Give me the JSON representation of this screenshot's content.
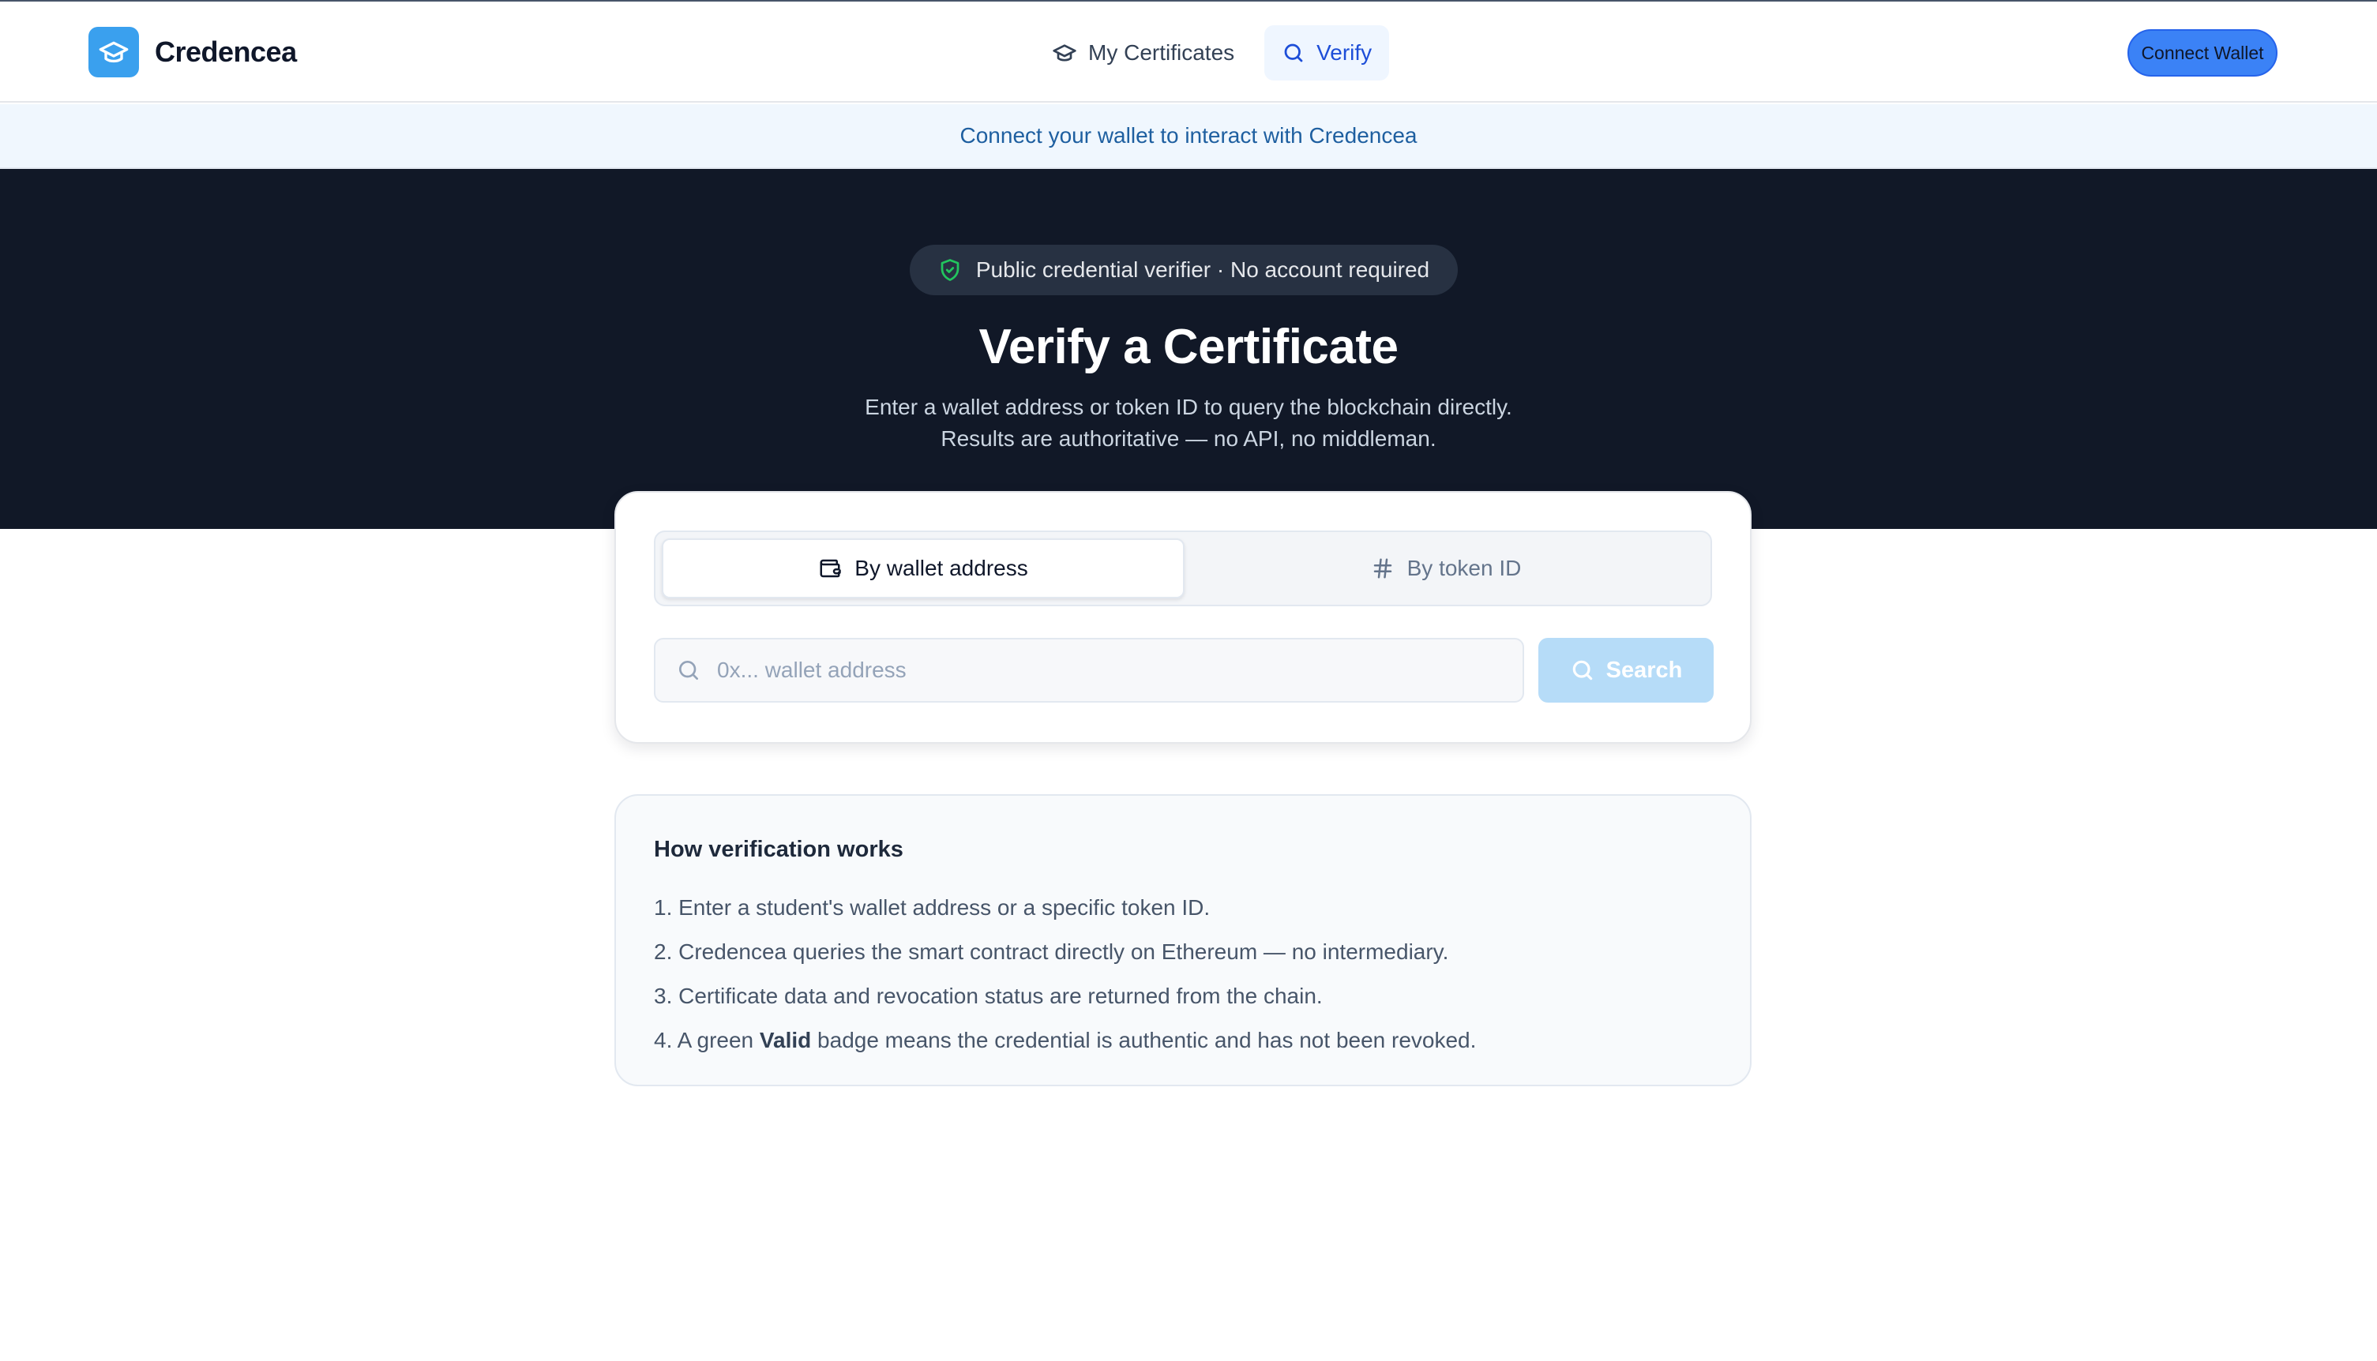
{
  "app": {
    "name": "Credencea"
  },
  "nav": {
    "items": [
      {
        "label": "My Certificates",
        "icon": "graduation-cap-icon",
        "active": false
      },
      {
        "label": "Verify",
        "icon": "search-icon",
        "active": true
      }
    ]
  },
  "header": {
    "connect_label": "Connect Wallet"
  },
  "notice": {
    "text": "Connect your wallet to interact with Credencea"
  },
  "hero": {
    "badge": "Public credential verifier · No account required",
    "title": "Verify a Certificate",
    "subtitle_line1": "Enter a wallet address or token ID to query the blockchain directly.",
    "subtitle_line2": "Results are authoritative — no API, no middleman."
  },
  "search": {
    "tabs": [
      {
        "label": "By wallet address",
        "icon": "wallet-icon",
        "active": true
      },
      {
        "label": "By token ID",
        "icon": "hash-icon",
        "active": false
      }
    ],
    "placeholder": "0x... wallet address",
    "value": "",
    "button_label": "Search"
  },
  "how": {
    "title": "How verification works",
    "steps": [
      "1. Enter a student's wallet address or a specific token ID.",
      "2. Credencea queries the smart contract directly on Ethereum — no intermediary.",
      "3. Certificate data and revocation status are returned from the chain."
    ],
    "step4_prefix": "4. A green ",
    "step4_bold": "Valid",
    "step4_suffix": " badge means the credential is authentic and has not been revoked."
  },
  "colors": {
    "brand": "#3aa0ee",
    "primary": "#3b82f6",
    "hero_bg": "#111827",
    "notice_bg": "#f0f7fe",
    "valid_green": "#22c55e"
  }
}
